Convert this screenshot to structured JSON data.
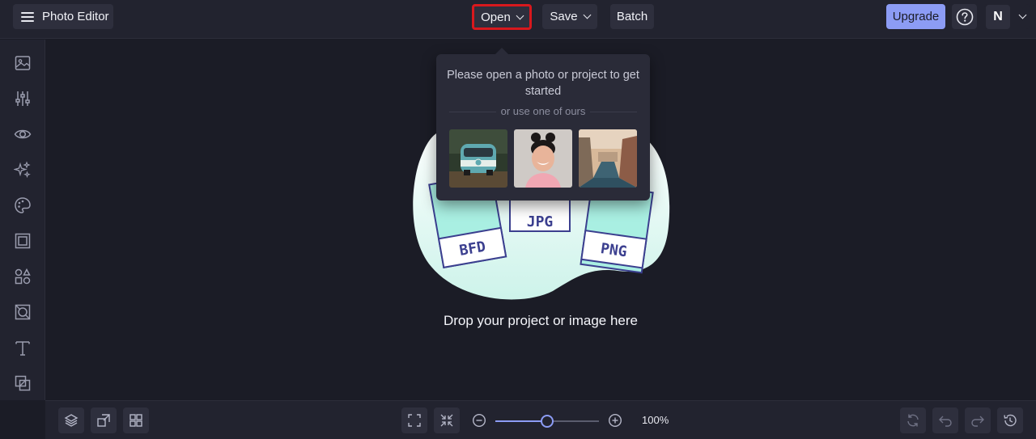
{
  "header": {
    "app_title": "Photo Editor",
    "open_label": "Open",
    "save_label": "Save",
    "batch_label": "Batch",
    "upgrade_label": "Upgrade",
    "avatar_initial": "N"
  },
  "colors": {
    "accent": "#8c9cf5",
    "highlight_box": "#d8181d",
    "background": "#1b1c26",
    "panel": "#22232f"
  },
  "sidebar": {
    "items": [
      {
        "icon": "image-icon"
      },
      {
        "icon": "adjustments-icon"
      },
      {
        "icon": "eye-icon"
      },
      {
        "icon": "sparkles-icon"
      },
      {
        "icon": "palette-icon"
      },
      {
        "icon": "frame-icon"
      },
      {
        "icon": "shapes-icon"
      },
      {
        "icon": "texture-icon"
      },
      {
        "icon": "text-icon"
      },
      {
        "icon": "overlay-icon"
      }
    ]
  },
  "open_popup": {
    "title": "Please open a photo or project to get started",
    "subtitle": "or use one of ours",
    "samples": [
      "van-photo",
      "woman-portrait-photo",
      "canal-city-photo"
    ]
  },
  "canvas": {
    "file_labels": [
      "BFD",
      "JPG",
      "PNG"
    ],
    "drop_text": "Drop your project or image here"
  },
  "bottombar": {
    "zoom_label": "100%",
    "zoom_level": 0.5
  }
}
